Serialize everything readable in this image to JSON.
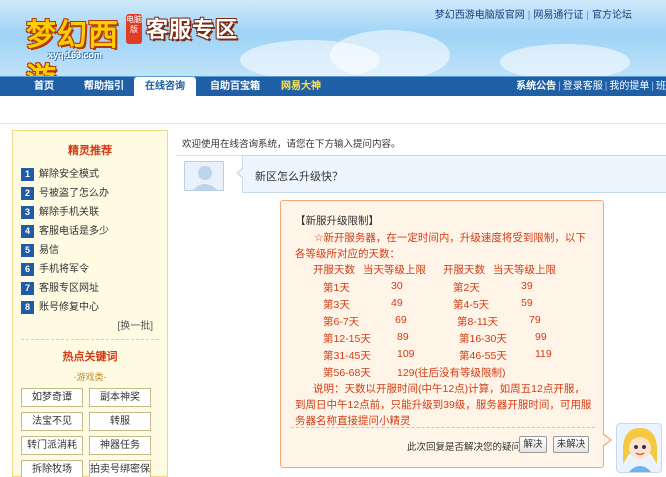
{
  "header": {
    "logo_text": "梦幻西游",
    "logo_badge": "电脑版",
    "logo_domain": "xyq.163.com",
    "site_title": "客服专区",
    "top_links": [
      "梦幻西游电脑版官网",
      "网易通行证",
      "官方论坛"
    ],
    "top_link_sep": "|"
  },
  "nav": {
    "items": [
      "首页",
      "帮助指引",
      "在线咨询",
      "自助百宝箱",
      "网易大神"
    ],
    "active_index": 2,
    "right_links": [
      "系统公告",
      "登录客服",
      "我的提单",
      "班"
    ],
    "right_sep": "|"
  },
  "sidebar": {
    "title": "精灵推荐",
    "items": [
      {
        "num": "1",
        "label": "解除安全模式"
      },
      {
        "num": "2",
        "label": "号被盗了怎么办"
      },
      {
        "num": "3",
        "label": "解除手机关联"
      },
      {
        "num": "4",
        "label": "客服电话是多少"
      },
      {
        "num": "5",
        "label": "易信"
      },
      {
        "num": "6",
        "label": "手机将军令"
      },
      {
        "num": "7",
        "label": "客服专区网址"
      },
      {
        "num": "8",
        "label": "账号修复中心"
      }
    ],
    "change_link": "[换一批]",
    "keywords_title": "热点关键词",
    "keywords_sub": "-游戏类-",
    "keywords": [
      "如梦奇谭",
      "副本神奖",
      "法宝不见",
      "转服",
      "转门派消耗",
      "神器任务",
      "拆除牧场",
      "拍卖号绑密保"
    ]
  },
  "chat": {
    "welcome": "欢迎使用在线咨询系统，请您在下方输入提问内容。",
    "user_question": "新区怎么升级快？",
    "answer": {
      "title": "【新服升级限制】",
      "intro": "☆新开服务器，在一定时间内，升级速度将受到限制，以下各等级所对应的天数：",
      "headers": [
        "开服天数",
        "当天等级上限",
        "开服天数",
        "当天等级上限"
      ],
      "rows": [
        [
          "第1天",
          "30",
          "第2天",
          "39"
        ],
        [
          "第3天",
          "49",
          "第4-5天",
          "59"
        ],
        [
          "第6-7天",
          "69",
          "第8-11天",
          "79"
        ],
        [
          "第12-15天",
          "89",
          "第16-30天",
          "99"
        ],
        [
          "第31-45天",
          "109",
          "第46-55天",
          "119"
        ]
      ],
      "last_row": [
        "第56-68天",
        "129(往后没有等级限制)"
      ],
      "note": "说明：天数以开服时间(中午12点)计算，如周五12点开服，到周日中午12点前，只能升级到39级，服务器开服时间，可用服务器名称直接提问小精灵"
    },
    "feedback_prompt": "此次回复是否解决您的疑问：",
    "resolved_button": "解决",
    "unresolved_button": "未解决"
  },
  "colors": {
    "nav_bg": "#1e5fa6",
    "accent_red": "#d43c15",
    "answer_bg": "#fff4e8",
    "answer_border": "#f3a774",
    "sidebar_bg": "#fffbe3"
  }
}
